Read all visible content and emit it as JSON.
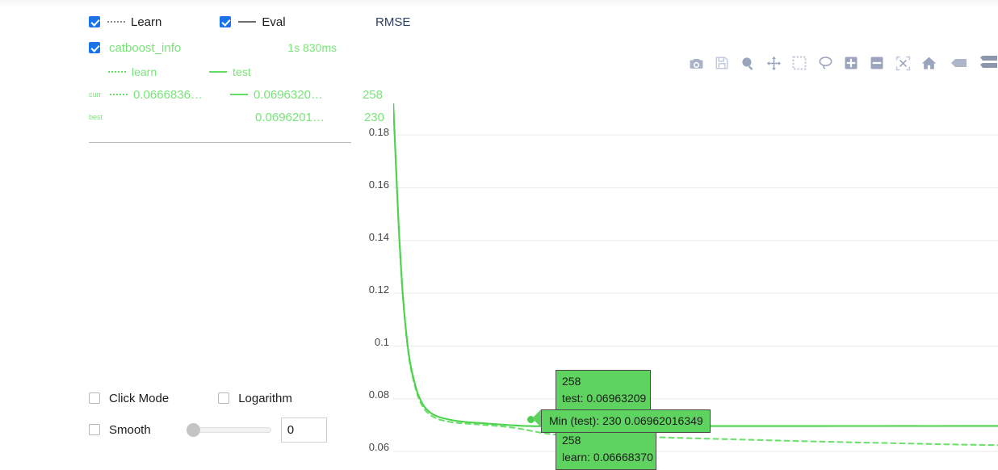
{
  "header": {
    "strip": ""
  },
  "legend": {
    "learn_label": "Learn",
    "eval_label": "Eval",
    "learn_checked": true,
    "eval_checked": true,
    "group": {
      "name": "catboost_info",
      "checked": true,
      "time": "1s 830ms",
      "learn_label": "learn",
      "test_label": "test",
      "rows": [
        {
          "tag": "curr",
          "learn_value": "0.0666836…",
          "test_value": "0.0696320…",
          "iteration": "258"
        },
        {
          "tag": "best",
          "learn_value": "",
          "test_value": "0.0696201…",
          "iteration": "230"
        }
      ]
    }
  },
  "controls": {
    "click_mode": {
      "label": "Click Mode",
      "checked": false
    },
    "logarithm": {
      "label": "Logarithm",
      "checked": false
    },
    "smooth": {
      "label": "Smooth",
      "checked": false
    },
    "slider_value": "0"
  },
  "chart": {
    "title": "RMSE",
    "modebar": [
      {
        "name": "download-plot-as-png-icon",
        "label": "Download plot as a png"
      },
      {
        "name": "save-icon",
        "label": "Save"
      },
      {
        "name": "zoom-icon",
        "label": "Zoom"
      },
      {
        "name": "pan-icon",
        "label": "Pan"
      },
      {
        "name": "box-select-icon",
        "label": "Box Select"
      },
      {
        "name": "lasso-select-icon",
        "label": "Lasso Select"
      },
      {
        "name": "zoom-in-icon",
        "label": "Zoom in"
      },
      {
        "name": "zoom-out-icon",
        "label": "Zoom out"
      },
      {
        "name": "autoscale-icon",
        "label": "Autoscale"
      },
      {
        "name": "reset-axes-home-icon",
        "label": "Reset axes"
      },
      {
        "name": "toggle-spike-lines-icon",
        "label": "Toggle Spike Lines"
      },
      {
        "name": "compare-data-on-hover-icon",
        "label": "Compare data on hover"
      }
    ],
    "tooltips": {
      "test": {
        "iteration": "258",
        "text": "test: 0.06963209"
      },
      "min": {
        "text": "Min (test): 230 0.06962016349"
      },
      "learn": {
        "iteration": "258",
        "text": "learn: 0.06668370"
      }
    }
  },
  "chart_data": {
    "type": "line",
    "title": "RMSE",
    "xlabel": "",
    "ylabel": "",
    "ylim": [
      0.053,
      0.192
    ],
    "yticks": [
      "0.18",
      "0.16",
      "0.14",
      "0.12",
      "0.1",
      "0.08",
      "0.06"
    ],
    "ytick_values": [
      0.18,
      0.16,
      0.14,
      0.12,
      0.1,
      0.08,
      0.06
    ],
    "xlim": [
      0,
      1000
    ],
    "grid": true,
    "legend_position": "external-left",
    "colors": {
      "learn": "#6ee06e",
      "test": "#4dd24d",
      "accent": "#5fd35f"
    },
    "series": [
      {
        "name": "learn",
        "dash": "dot",
        "color": "#6ee06e",
        "x": [
          0,
          5,
          10,
          15,
          20,
          25,
          30,
          40,
          50,
          60,
          70,
          80,
          100,
          120,
          150,
          200,
          258,
          300,
          400,
          500,
          600,
          700,
          800,
          900,
          1000
        ],
        "y": [
          0.1925,
          0.166,
          0.141,
          0.122,
          0.108,
          0.0975,
          0.0905,
          0.0815,
          0.0766,
          0.0741,
          0.0727,
          0.0719,
          0.071,
          0.0706,
          0.0701,
          0.069,
          0.066684,
          0.0665,
          0.0657,
          0.065,
          0.0644,
          0.0638,
          0.0633,
          0.0628,
          0.0624
        ]
      },
      {
        "name": "test",
        "dash": "solid",
        "color": "#4dd24d",
        "x": [
          0,
          5,
          10,
          15,
          20,
          25,
          30,
          40,
          50,
          60,
          70,
          80,
          100,
          120,
          150,
          200,
          230,
          258,
          300,
          400,
          500,
          600,
          700,
          800,
          900,
          1000
        ],
        "y": [
          0.1925,
          0.166,
          0.141,
          0.122,
          0.1085,
          0.0982,
          0.0913,
          0.0824,
          0.0775,
          0.075,
          0.0736,
          0.0728,
          0.0718,
          0.0712,
          0.0707,
          0.0699,
          0.06962,
          0.069632,
          0.06964,
          0.06966,
          0.06967,
          0.06968,
          0.06968,
          0.06969,
          0.06969,
          0.0697
        ]
      }
    ],
    "annotations": [
      {
        "label": "258 / test: 0.06963209",
        "x": 258,
        "y": 0.06963209
      },
      {
        "label": "Min (test): 230 0.06962016349",
        "x": 230,
        "y": 0.06962016349
      },
      {
        "label": "258 / learn: 0.06668370",
        "x": 258,
        "y": 0.0666837
      }
    ]
  }
}
